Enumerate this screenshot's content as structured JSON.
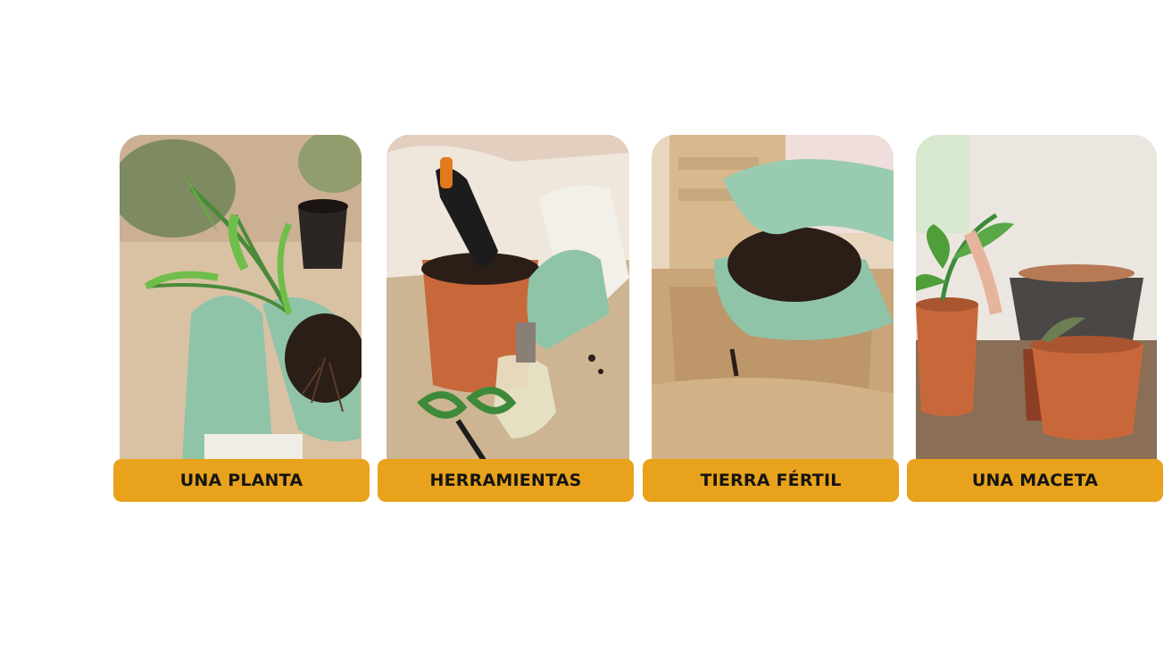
{
  "cards": [
    {
      "label": "UNA PLANTA",
      "icon": "plant-seedling-photo"
    },
    {
      "label": "HERRAMIENTAS",
      "icon": "gardening-tools-photo"
    },
    {
      "label": "TIERRA FÉRTIL",
      "icon": "fertile-soil-photo"
    },
    {
      "label": "UNA MACETA",
      "icon": "flower-pot-photo"
    }
  ],
  "colors": {
    "label_bg": "#e8a21b",
    "label_text": "#141414",
    "glove": "#8fc4a8",
    "terracotta": "#c8683a",
    "soil": "#2b1e17",
    "kraft": "#c9a579"
  }
}
